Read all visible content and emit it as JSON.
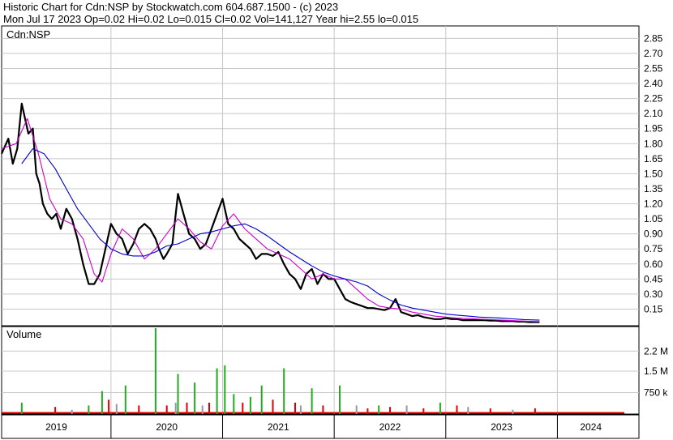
{
  "header": {
    "line1": "Historic Chart for Cdn:NSP by Stockwatch.com 604.687.1500 - (c) 2023",
    "line2": "Mon Jul 17 2023  Op=0.02  Hi=0.02  Lo=0.015  Cl=0.02  Vol=141,127  Year hi=2.55  lo=0.015"
  },
  "colors": {
    "price": "#000000",
    "ma_short": "#cc00cc",
    "ma_long": "#0000cc",
    "grid": "#c8c8c8",
    "volume_up": "#22aa22",
    "volume_down": "#dd0000",
    "volume_neutral": "#999999"
  },
  "chart_data": [
    {
      "type": "line",
      "ylabel": "Cdn:NSP",
      "x_ticks": [
        "2019",
        "2020",
        "2021",
        "2022",
        "2023",
        "2024"
      ],
      "y_ticks": [
        "2.85",
        "2.70",
        "2.55",
        "2.40",
        "2.25",
        "2.10",
        "1.95",
        "1.80",
        "1.65",
        "1.50",
        "1.35",
        "1.20",
        "1.05",
        "0.90",
        "0.75",
        "0.60",
        "0.45",
        "0.30",
        "0.15"
      ],
      "ylim": [
        0,
        2.95
      ],
      "xlim": [
        2018.72,
        2024.3
      ],
      "grid": true,
      "series": [
        {
          "key": "price",
          "x": [
            2018.72,
            2018.78,
            2018.82,
            2018.86,
            2018.9,
            2018.93,
            2018.96,
            2019.0,
            2019.03,
            2019.06,
            2019.09,
            2019.13,
            2019.17,
            2019.21,
            2019.25,
            2019.3,
            2019.35,
            2019.4,
            2019.45,
            2019.5,
            2019.55,
            2019.6,
            2019.65,
            2019.7,
            2019.75,
            2019.8,
            2019.85,
            2019.9,
            2019.95,
            2020.0,
            2020.05,
            2020.1,
            2020.13,
            2020.17,
            2020.2,
            2020.25,
            2020.3,
            2020.35,
            2020.4,
            2020.45,
            2020.5,
            2020.55,
            2020.6,
            2020.65,
            2020.7,
            2020.75,
            2020.8,
            2020.85,
            2020.9,
            2020.95,
            2021.0,
            2021.05,
            2021.1,
            2021.15,
            2021.2,
            2021.25,
            2021.3,
            2021.35,
            2021.4,
            2021.45,
            2021.5,
            2021.55,
            2021.6,
            2021.65,
            2021.7,
            2021.75,
            2021.8,
            2021.85,
            2021.9,
            2021.95,
            2022.0,
            2022.05,
            2022.1,
            2022.15,
            2022.2,
            2022.25,
            2022.3,
            2022.35,
            2022.4,
            2022.45,
            2022.5,
            2022.55,
            2022.6,
            2022.65,
            2022.7,
            2022.75,
            2022.8,
            2022.85,
            2022.9,
            2022.95,
            2023.0,
            2023.05,
            2023.1,
            2023.15,
            2023.2,
            2023.25,
            2023.3,
            2023.35,
            2023.4,
            2023.45,
            2023.5,
            2023.54
          ],
          "y": [
            1.7,
            1.85,
            1.6,
            1.75,
            2.2,
            2.05,
            1.9,
            1.95,
            1.5,
            1.4,
            1.2,
            1.1,
            1.05,
            1.1,
            0.95,
            1.15,
            1.05,
            0.85,
            0.6,
            0.4,
            0.4,
            0.5,
            0.75,
            1.0,
            0.9,
            0.85,
            0.7,
            0.8,
            0.95,
            1.0,
            0.95,
            0.85,
            0.75,
            0.65,
            0.7,
            0.8,
            1.3,
            1.1,
            0.9,
            0.85,
            0.75,
            0.8,
            0.95,
            1.1,
            1.25,
            1.0,
            0.95,
            0.85,
            0.8,
            0.75,
            0.65,
            0.7,
            0.7,
            0.68,
            0.72,
            0.6,
            0.5,
            0.45,
            0.35,
            0.5,
            0.55,
            0.4,
            0.5,
            0.45,
            0.45,
            0.35,
            0.25,
            0.22,
            0.2,
            0.18,
            0.16,
            0.16,
            0.15,
            0.14,
            0.16,
            0.25,
            0.12,
            0.1,
            0.08,
            0.09,
            0.07,
            0.06,
            0.05,
            0.05,
            0.06,
            0.05,
            0.05,
            0.04,
            0.04,
            0.04,
            0.04,
            0.04,
            0.035,
            0.035,
            0.03,
            0.03,
            0.03,
            0.025,
            0.025,
            0.02,
            0.02,
            0.02
          ]
        },
        {
          "key": "ma_short",
          "x": [
            2018.72,
            2018.85,
            2018.95,
            2019.05,
            2019.15,
            2019.25,
            2019.35,
            2019.45,
            2019.55,
            2019.62,
            2019.7,
            2019.8,
            2019.9,
            2020.0,
            2020.1,
            2020.2,
            2020.3,
            2020.4,
            2020.5,
            2020.6,
            2020.7,
            2020.8,
            2020.9,
            2021.0,
            2021.1,
            2021.2,
            2021.3,
            2021.4,
            2021.5,
            2021.6,
            2021.7,
            2021.8,
            2021.9,
            2022.0,
            2022.1,
            2022.2,
            2022.3,
            2022.4,
            2022.5,
            2022.6,
            2022.7,
            2022.8,
            2022.9,
            2023.0,
            2023.2,
            2023.4,
            2023.54
          ],
          "y": [
            1.75,
            1.8,
            2.05,
            1.7,
            1.25,
            1.05,
            1.0,
            0.85,
            0.5,
            0.42,
            0.7,
            0.95,
            0.85,
            0.65,
            0.75,
            0.9,
            1.05,
            0.95,
            0.82,
            0.75,
            0.98,
            1.1,
            0.95,
            0.85,
            0.75,
            0.7,
            0.65,
            0.55,
            0.45,
            0.5,
            0.45,
            0.45,
            0.35,
            0.25,
            0.18,
            0.16,
            0.15,
            0.12,
            0.1,
            0.08,
            0.07,
            0.06,
            0.055,
            0.05,
            0.04,
            0.03,
            0.025
          ]
        },
        {
          "key": "ma_long",
          "x": [
            2018.9,
            2019.0,
            2019.1,
            2019.2,
            2019.3,
            2019.4,
            2019.5,
            2019.6,
            2019.7,
            2019.8,
            2019.9,
            2020.0,
            2020.1,
            2020.2,
            2020.3,
            2020.4,
            2020.5,
            2020.6,
            2020.7,
            2020.8,
            2020.9,
            2021.0,
            2021.1,
            2021.2,
            2021.3,
            2021.4,
            2021.5,
            2021.6,
            2021.7,
            2021.8,
            2021.9,
            2022.0,
            2022.1,
            2022.2,
            2022.3,
            2022.4,
            2022.5,
            2022.6,
            2022.7,
            2022.8,
            2022.9,
            2023.0,
            2023.2,
            2023.4,
            2023.54
          ],
          "y": [
            1.6,
            1.75,
            1.7,
            1.55,
            1.35,
            1.15,
            1.0,
            0.85,
            0.75,
            0.7,
            0.68,
            0.68,
            0.72,
            0.78,
            0.8,
            0.85,
            0.9,
            0.92,
            0.95,
            0.98,
            1.0,
            0.95,
            0.88,
            0.8,
            0.72,
            0.65,
            0.58,
            0.52,
            0.48,
            0.45,
            0.42,
            0.38,
            0.3,
            0.24,
            0.19,
            0.16,
            0.14,
            0.12,
            0.1,
            0.09,
            0.08,
            0.07,
            0.06,
            0.045,
            0.04
          ]
        }
      ]
    },
    {
      "type": "bar",
      "ylabel": "Volume",
      "y_ticks": [
        "2.2 M",
        "1.5 M",
        "750 k"
      ],
      "ylim": [
        0,
        3000000
      ],
      "x": [
        2018.9,
        2019.2,
        2019.35,
        2019.5,
        2019.62,
        2019.68,
        2019.75,
        2019.83,
        2019.95,
        2020.1,
        2020.2,
        2020.28,
        2020.3,
        2020.38,
        2020.45,
        2020.52,
        2020.58,
        2020.65,
        2020.72,
        2020.8,
        2020.88,
        2020.95,
        2021.05,
        2021.15,
        2021.25,
        2021.35,
        2021.4,
        2021.5,
        2021.6,
        2021.75,
        2021.9,
        2022.0,
        2022.1,
        2022.2,
        2022.35,
        2022.5,
        2022.65,
        2022.8,
        2022.9,
        2023.1,
        2023.3,
        2023.5
      ],
      "values": [
        400000,
        250000,
        150000,
        300000,
        800000,
        500000,
        350000,
        1000000,
        300000,
        3000000,
        300000,
        400000,
        1400000,
        400000,
        1100000,
        300000,
        400000,
        1600000,
        1700000,
        700000,
        400000,
        600000,
        1000000,
        500000,
        1600000,
        400000,
        300000,
        900000,
        300000,
        1000000,
        300000,
        200000,
        300000,
        250000,
        300000,
        200000,
        400000,
        300000,
        250000,
        200000,
        150000,
        200000
      ],
      "colors": [
        "volume_up",
        "volume_down",
        "volume_neutral",
        "volume_up",
        "volume_up",
        "volume_down",
        "volume_neutral",
        "volume_up",
        "volume_down",
        "volume_up",
        "volume_down",
        "volume_neutral",
        "volume_up",
        "volume_down",
        "volume_up",
        "volume_neutral",
        "volume_down",
        "volume_up",
        "volume_up",
        "volume_up",
        "volume_down",
        "volume_up",
        "volume_up",
        "volume_down",
        "volume_up",
        "volume_down",
        "volume_neutral",
        "volume_up",
        "volume_down",
        "volume_up",
        "volume_neutral",
        "volume_down",
        "volume_up",
        "volume_down",
        "volume_neutral",
        "volume_down",
        "volume_up",
        "volume_down",
        "volume_neutral",
        "volume_down",
        "volume_neutral",
        "volume_down"
      ]
    }
  ]
}
